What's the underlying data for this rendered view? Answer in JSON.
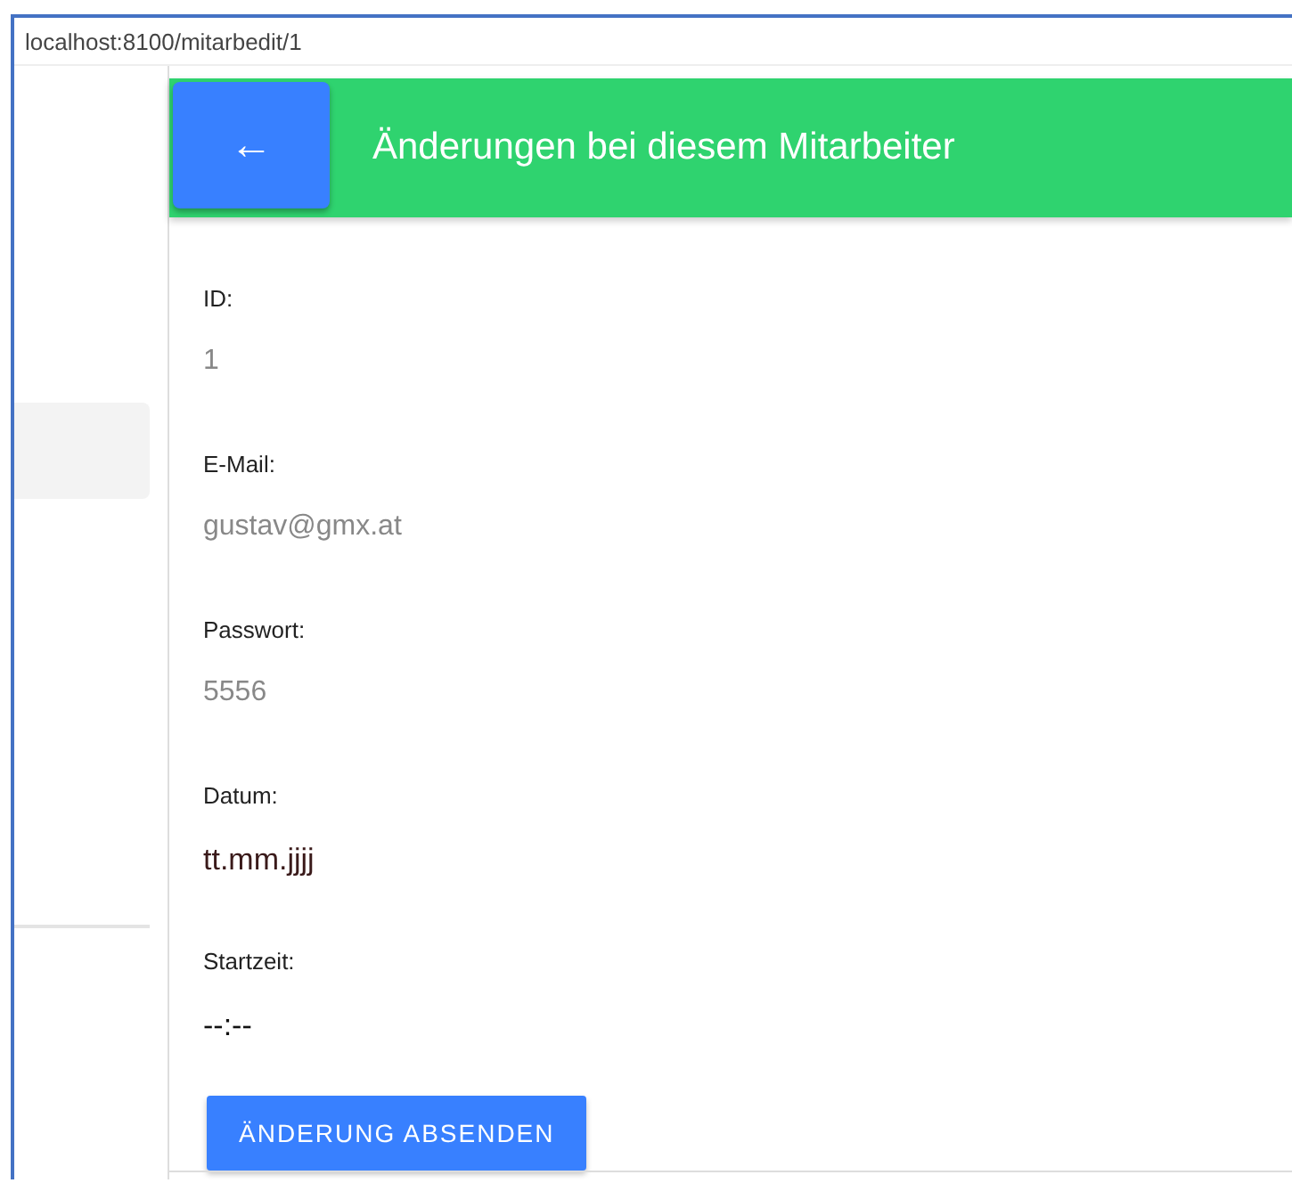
{
  "address_bar": {
    "url": "localhost:8100/mitarbedit/1"
  },
  "header": {
    "back_icon": "←",
    "title": "Änderungen bei diesem Mitarbeiter"
  },
  "fields": [
    {
      "label": "ID:",
      "value": "1",
      "kind": "readonly"
    },
    {
      "label": "E-Mail:",
      "value": "gustav@gmx.at",
      "kind": "readonly"
    },
    {
      "label": "Passwort:",
      "value": "5556",
      "kind": "readonly"
    },
    {
      "label": "Datum:",
      "value": "tt.mm.jjjj",
      "kind": "date"
    },
    {
      "label": "Startzeit:",
      "value": "--:--",
      "kind": "time"
    }
  ],
  "submit_button": {
    "label": "ÄNDERUNG ABSENDEN"
  }
}
